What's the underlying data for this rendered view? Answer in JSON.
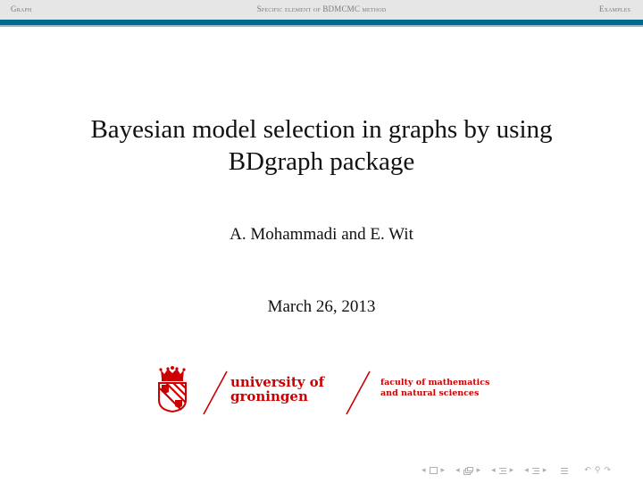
{
  "headline": {
    "sections": [
      "Graph",
      "Specific element of BDMCMC method",
      "Examples"
    ]
  },
  "colors": {
    "headline_bg": "#e6e6e6",
    "headline_text": "#7a7a7a",
    "bar": "#00688c",
    "logo_red": "#cc0000",
    "nav_icons": "#b0b0b0"
  },
  "slide": {
    "title_line1": "Bayesian model selection in graphs by using",
    "title_line2": "BDgraph package",
    "authors": "A. Mohammadi and E. Wit",
    "date": "March 26, 2013"
  },
  "logo": {
    "university_line1": "university of",
    "university_line2": "groningen",
    "faculty_line1": "faculty of mathematics",
    "faculty_line2": "and natural sciences"
  },
  "navigation": {
    "icons": [
      "frame-prev-icon",
      "frame-icon",
      "frame-next-icon",
      "subsection-prev-icon",
      "subsection-icon",
      "subsection-next-icon",
      "section-prev-icon",
      "section-icon",
      "section-next-icon",
      "subsubsection-prev-icon",
      "subsubsection-icon",
      "subsubsection-next-icon",
      "document-icon",
      "back-icon",
      "search-icon",
      "forward-icon"
    ]
  }
}
